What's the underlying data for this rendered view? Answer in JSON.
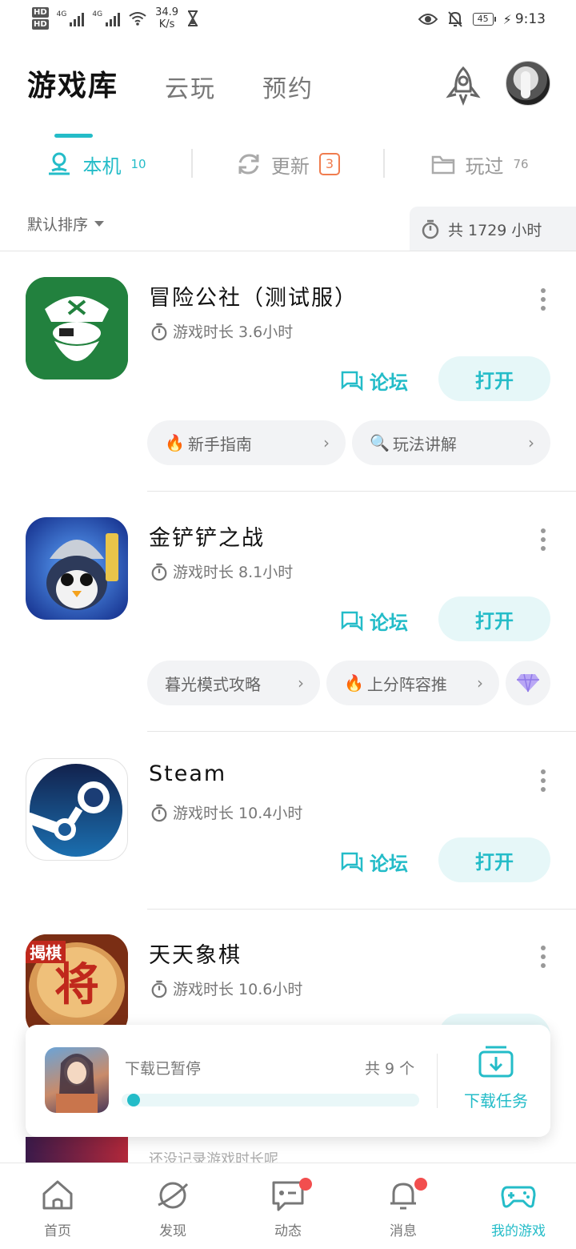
{
  "status_bar": {
    "hd1": "HD",
    "hd2": "HD",
    "net1": "4G",
    "net2": "4G",
    "speed_value": "34.9",
    "speed_unit": "K/s",
    "battery": "45",
    "time": "9:13"
  },
  "header": {
    "tabs": [
      {
        "label": "游戏库"
      },
      {
        "label": "云玩"
      },
      {
        "label": "预约"
      }
    ]
  },
  "sub_tabs": [
    {
      "label": "本机",
      "count": "10"
    },
    {
      "label": "更新",
      "count": "3"
    },
    {
      "label": "玩过",
      "count": "76"
    }
  ],
  "sort": {
    "label": "默认排序",
    "total_label": "共 1729 小时"
  },
  "games": [
    {
      "name": "冒险公社（测试服）",
      "playtime": "游戏时长 3.6小时",
      "forum": "论坛",
      "open": "打开",
      "chips": [
        {
          "icon": "🔥",
          "label": "新手指南"
        },
        {
          "icon": "🔍",
          "label": "玩法讲解"
        }
      ]
    },
    {
      "name": "金铲铲之战",
      "playtime": "游戏时长 8.1小时",
      "forum": "论坛",
      "open": "打开",
      "chips": [
        {
          "icon": "",
          "label": "暮光模式攻略"
        },
        {
          "icon": "🔥",
          "label": "上分阵容推"
        }
      ]
    },
    {
      "name": "Steam",
      "playtime": "游戏时长 10.4小时",
      "forum": "论坛",
      "open": "打开"
    },
    {
      "name": "天天象棋",
      "playtime": "游戏时长 10.6小时",
      "icon_badge": "揭棋",
      "icon_glyph": "将"
    }
  ],
  "partial_game": {
    "playtime": "还没记录游戏时长呢"
  },
  "download": {
    "status": "下载已暂停",
    "count": "共 9 个",
    "progress": 0.02,
    "task_label": "下载任务"
  },
  "bottom_nav": [
    {
      "label": "首页"
    },
    {
      "label": "发现"
    },
    {
      "label": "动态"
    },
    {
      "label": "消息"
    },
    {
      "label": "我的游戏"
    }
  ],
  "colors": {
    "accent": "#24bcc8",
    "badge_orange": "#f07c4e",
    "notification_red": "#f24e4e"
  }
}
